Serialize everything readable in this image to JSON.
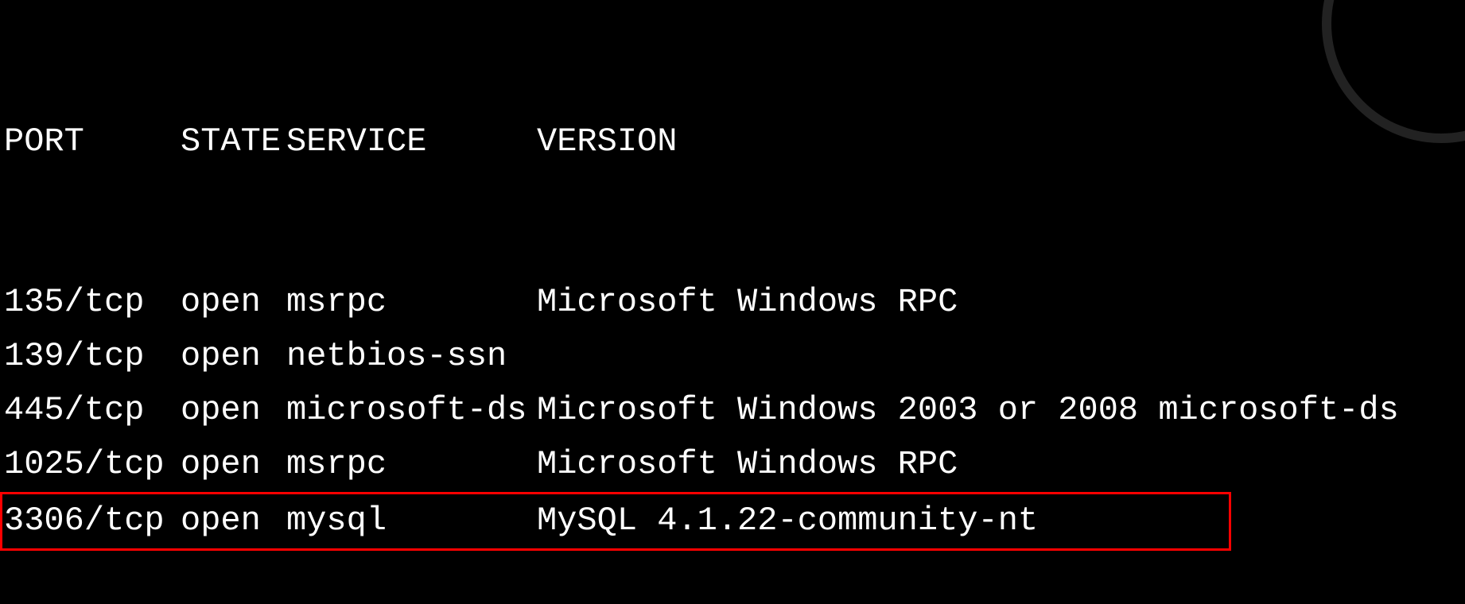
{
  "header": {
    "port": "PORT",
    "state": "STATE",
    "service": "SERVICE",
    "version": "VERSION"
  },
  "rows": [
    {
      "port": "135/tcp",
      "state": "open",
      "service": "msrpc",
      "version": "Microsoft Windows RPC",
      "highlighted": false
    },
    {
      "port": "139/tcp",
      "state": "open",
      "service": "netbios-ssn",
      "version": "",
      "highlighted": false
    },
    {
      "port": "445/tcp",
      "state": "open",
      "service": "microsoft-ds",
      "version": "Microsoft Windows 2003 or 2008 microsoft-ds",
      "highlighted": false
    },
    {
      "port": "1025/tcp",
      "state": "open",
      "service": "msrpc",
      "version": "Microsoft Windows RPC",
      "highlighted": false
    },
    {
      "port": "3306/tcp",
      "state": "open",
      "service": "mysql",
      "version": "MySQL 4.1.22-community-nt",
      "highlighted": true
    }
  ]
}
